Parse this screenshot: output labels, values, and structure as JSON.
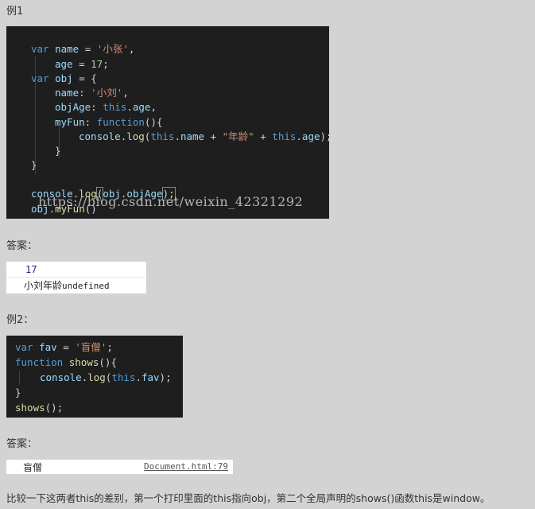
{
  "example1": {
    "label": "例1",
    "code_lines": {
      "l1": {
        "kw": "var",
        "name": "name",
        "eq": " = ",
        "str": "'小张'",
        "end": ","
      },
      "l2": {
        "name": "age",
        "eq": " = ",
        "num": "17",
        "end": ";"
      },
      "l3": {
        "kw": "var",
        "name": "obj",
        "eq": " = {"
      },
      "l4": {
        "name": "name",
        "colon": ": ",
        "str": "'小刘'",
        "end": ","
      },
      "l5": {
        "name": "objAge",
        "colon": ": ",
        "this": "this",
        "prop": ".age",
        "end": ","
      },
      "l6": {
        "name": "myFun",
        "colon": ": ",
        "kw": "function",
        "end": "(){"
      },
      "l7": {
        "fn": "console",
        "dot": ".",
        "call": "log",
        "open": "(",
        "this1": "this",
        "p1": ".name",
        "plus1": " + ",
        "str": "\"年龄\"",
        "plus2": " + ",
        "this2": "this",
        "p2": ".age",
        "close": ");"
      },
      "l8": "}",
      "l9": "}",
      "l10": {
        "fn": "console",
        "dot": ".",
        "call": "log",
        "open": "(",
        "arg": "obj.objAge",
        "close": ");"
      },
      "l11": {
        "obj": "obj",
        "dot": ".",
        "call": "myFun",
        "close": "()"
      }
    },
    "watermark": "https://blog.csdn.net/weixin_42321292"
  },
  "answer1": {
    "label": "答案：",
    "line1": "17",
    "line2_cn": "小刘年龄",
    "line2_en": "undefined"
  },
  "example2": {
    "label": "例2：",
    "code_lines": {
      "l1": {
        "kw": "var",
        "name": "fav",
        "eq": " = ",
        "str": "'盲僧'",
        "end": ";"
      },
      "l2": {
        "kw": "function",
        "fn": "shows",
        "end": "(){"
      },
      "l3": {
        "fn": "console",
        "dot": ".",
        "call": "log",
        "open": "(",
        "this": "this",
        "prop": ".fav",
        "close": ");"
      },
      "l4": "}",
      "l5": {
        "fn": "shows",
        "close": "();"
      }
    }
  },
  "answer2": {
    "label": "答案：",
    "value": "盲僧",
    "source": "Document.html:79"
  },
  "conclusion": "比较一下这两者this的差别，第一个打印里面的this指向obj，第二个全局声明的shows()函数this是window。"
}
